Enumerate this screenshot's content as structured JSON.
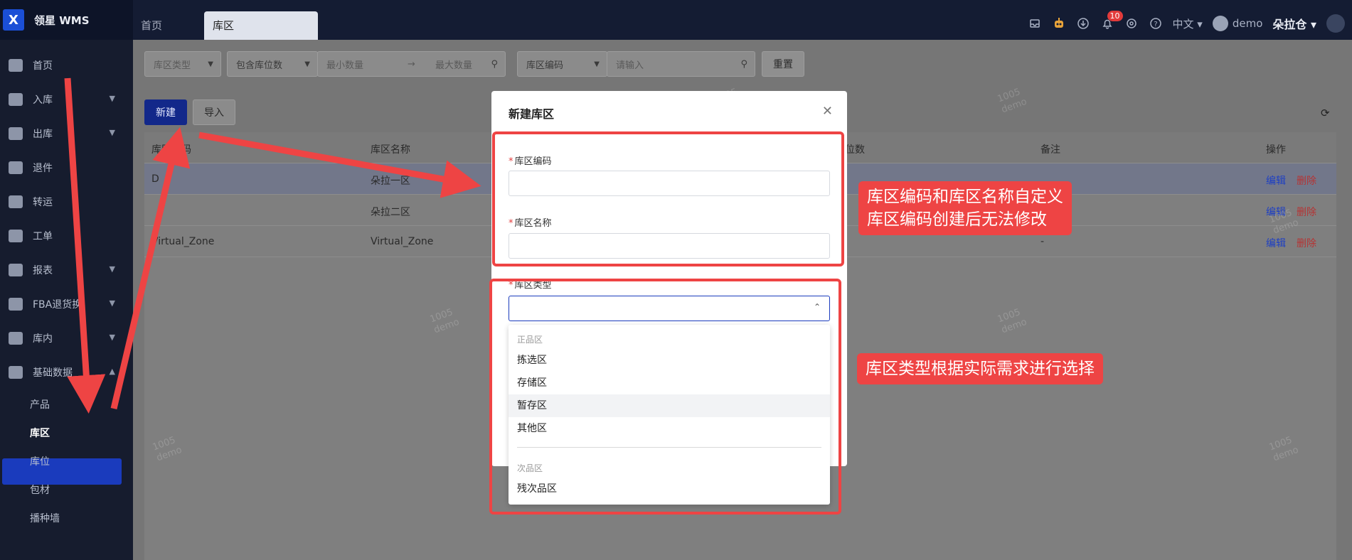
{
  "app": {
    "logo_text": "X",
    "brand_name": "领星 WMS"
  },
  "tabs": [
    {
      "label": "首页"
    },
    {
      "label": "库区"
    }
  ],
  "topbar": {
    "notification_count": "10",
    "language": "中文 ▾",
    "user_name": "demo",
    "warehouse_name": "朵拉仓 ▾"
  },
  "sidebar": {
    "items": [
      {
        "label": "首页",
        "icon": "home-icon"
      },
      {
        "label": "入库",
        "icon": "inbound-icon"
      },
      {
        "label": "出库",
        "icon": "outbound-icon"
      },
      {
        "label": "退件",
        "icon": "return-icon"
      },
      {
        "label": "转运",
        "icon": "transfer-icon"
      },
      {
        "label": "工单",
        "icon": "workorder-icon"
      },
      {
        "label": "报表",
        "icon": "report-icon"
      },
      {
        "label": "FBA退货换",
        "icon": "fba-icon"
      },
      {
        "label": "库内",
        "icon": "inventory-icon"
      },
      {
        "label": "基础数据",
        "icon": "basedata-icon"
      }
    ],
    "sub_items": [
      {
        "label": "产品"
      },
      {
        "label": "库区"
      },
      {
        "label": "库位"
      },
      {
        "label": "包材"
      },
      {
        "label": "播种墙"
      }
    ]
  },
  "filters": {
    "zone_type_placeholder": "库区类型",
    "location_count_label": "包含库位数",
    "min_placeholder": "最小数量",
    "range_arrow": "→",
    "max_placeholder": "最大数量",
    "code_select": "库区编码",
    "input_placeholder": "请输入",
    "reset_label": "重置"
  },
  "actions": {
    "new_label": "新建",
    "import_label": "导入",
    "refresh_icon": "refresh-icon"
  },
  "table": {
    "headers": {
      "code": "库区编码",
      "name": "库区名称",
      "count": "位数",
      "remark": "备注",
      "ops": "操作"
    },
    "rows": [
      {
        "code": "D",
        "name": "朵拉一区",
        "remark": "",
        "edit": "编辑",
        "delete": "删除"
      },
      {
        "code": "",
        "name": "朵拉二区",
        "remark": "",
        "edit": "编辑",
        "delete": "删除"
      },
      {
        "code": "Virtual_Zone",
        "name": "Virtual_Zone",
        "remark": "-",
        "edit": "编辑",
        "delete": "删除"
      }
    ]
  },
  "modal": {
    "title": "新建库区",
    "close_icon": "close-icon",
    "required_mark": "*",
    "code_label": "库区编码",
    "name_label": "库区名称",
    "type_label": "库区类型"
  },
  "dropdown": {
    "group1": "正品区",
    "options1": [
      "拣选区",
      "存储区",
      "暂存区",
      "其他区"
    ],
    "group2": "次品区",
    "options2": [
      "残次品区"
    ]
  },
  "annotations": {
    "callout1_line1": "库区编码和库区名称自定义",
    "callout1_line2": "库区编码创建后无法修改",
    "callout2": "库区类型根据实际需求进行选择",
    "color": "#ee4444"
  },
  "watermark": {
    "line1": "1005",
    "line2": "demo"
  }
}
